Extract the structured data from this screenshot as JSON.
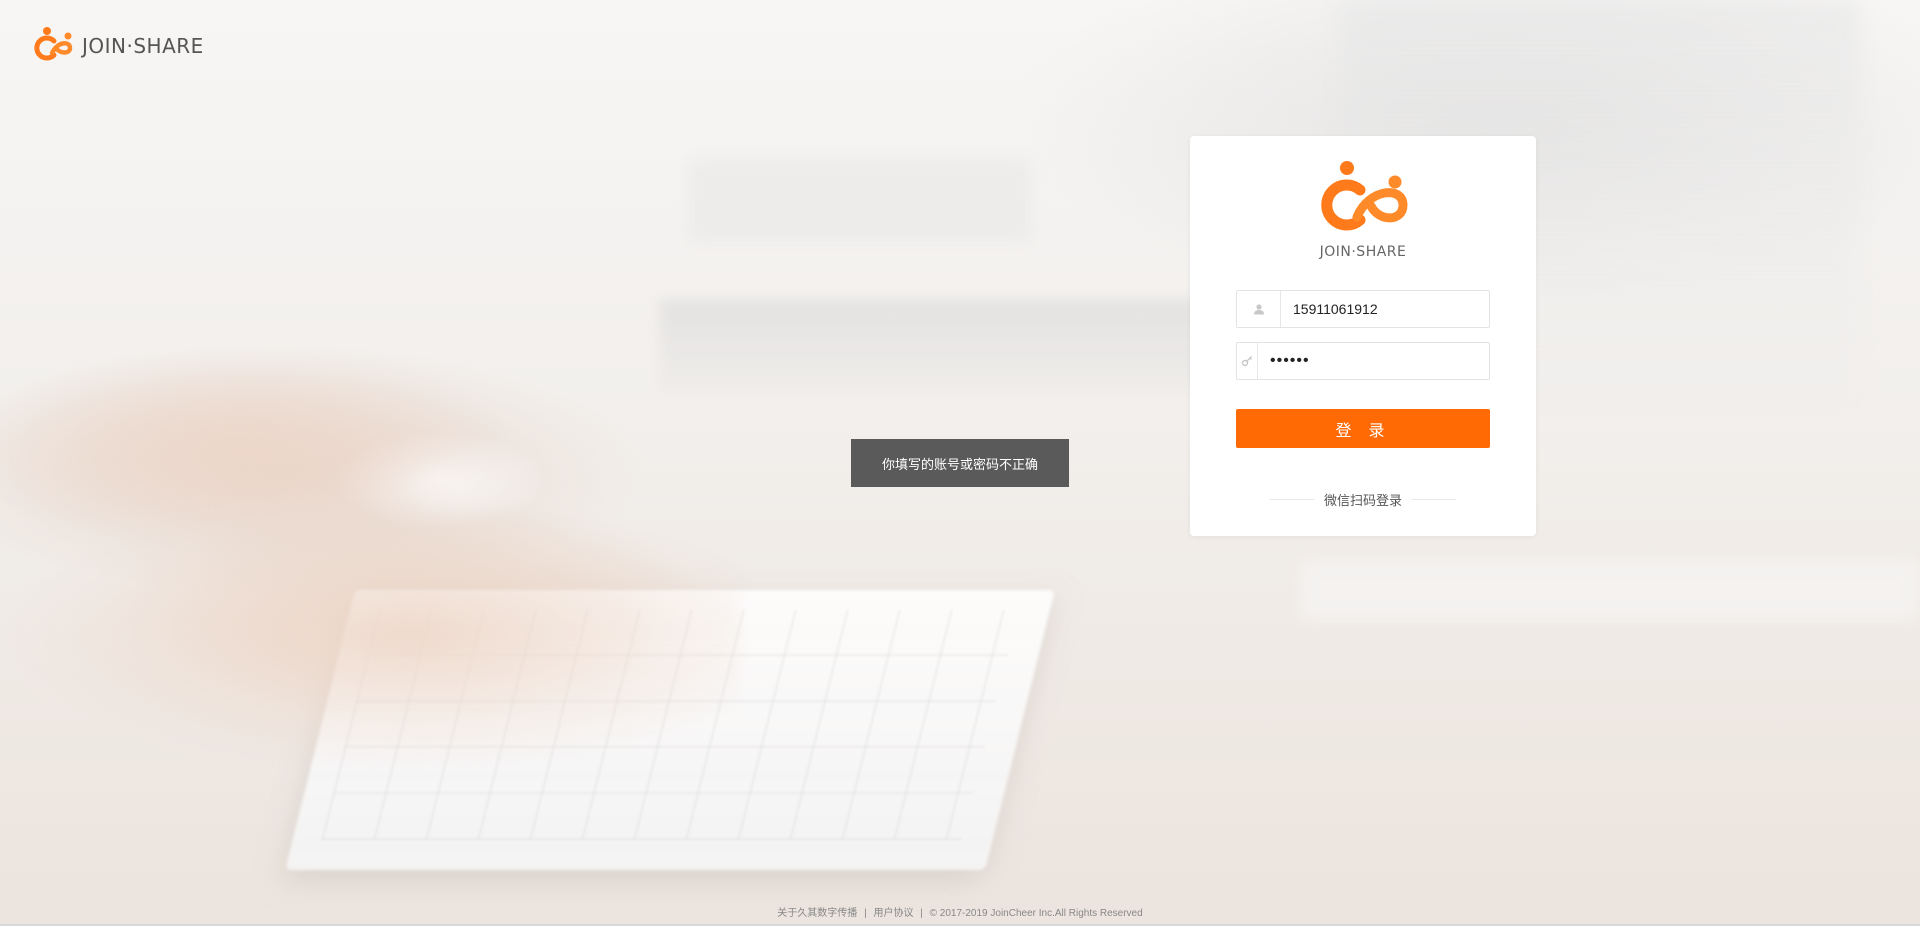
{
  "brand": {
    "name": "JOIN·SHARE",
    "primary_color": "#ff6a05",
    "logo_icon": "join-share-logo-icon"
  },
  "login_form": {
    "username": {
      "value": "15911061912",
      "icon": "user-icon"
    },
    "password": {
      "value": "123456",
      "icon": "key-icon"
    },
    "submit_label": "登 录",
    "wechat_login_label": "微信扫码登录"
  },
  "toast": {
    "message": "你填写的账号或密码不正确"
  },
  "footer": {
    "about_link": "关于久其数字传播",
    "separator": "|",
    "agreement_link": "用户协议",
    "copyright": "© 2017-2019 JoinCheer Inc.All Rights Reserved"
  }
}
